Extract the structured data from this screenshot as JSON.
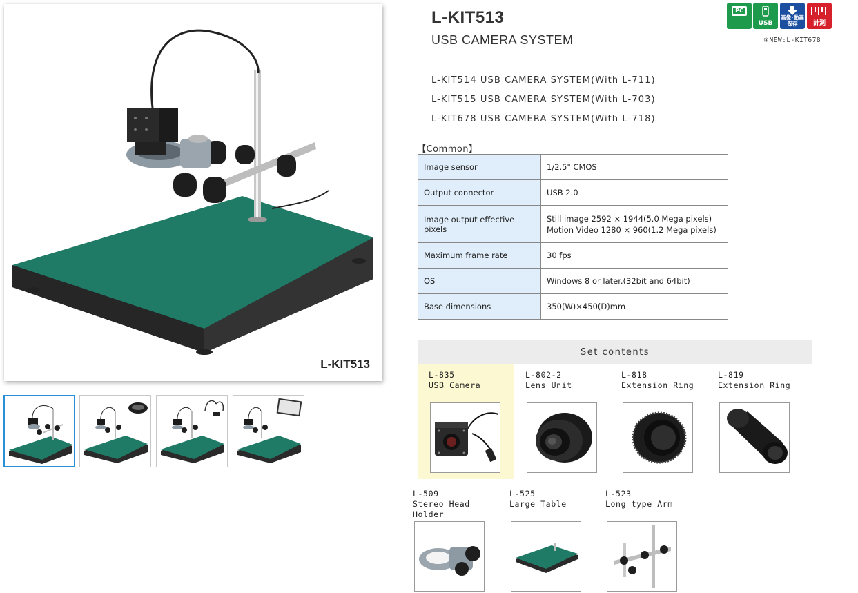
{
  "product": {
    "title": "L-KIT513",
    "subtitle": "USB CAMERA SYSTEM",
    "image_caption": "L-KIT513",
    "new_note": "※NEW:L-KIT678"
  },
  "badges": [
    {
      "label": "PC",
      "icon": "pc-icon",
      "color": "#1e9a4c"
    },
    {
      "label": "USB",
      "icon": "usb-icon",
      "color": "#1e9a4c"
    },
    {
      "label": "画像･動画 保存",
      "icon": "save-download-icon",
      "color": "#1d4fa0"
    },
    {
      "label": "計測",
      "icon": "measure-ruler-icon",
      "color": "#d6202c"
    }
  ],
  "variants": [
    "L-KIT514 USB CAMERA SYSTEM(With L-711)",
    "L-KIT515 USB CAMERA SYSTEM(With L-703)",
    "L-KIT678 USB CAMERA SYSTEM(With L-718)"
  ],
  "spec": {
    "section_label": "【Common】",
    "rows": [
      {
        "key": "Image sensor",
        "values": [
          "1/2.5\" CMOS"
        ]
      },
      {
        "key": "Output connector",
        "values": [
          "USB 2.0"
        ]
      },
      {
        "key": "Image output effective pixels",
        "values": [
          "Still image 2592 × 1944(5.0 Mega pixels)",
          "Motion Video 1280 × 960(1.2 Mega pixels)"
        ]
      },
      {
        "key": "Maximum frame rate",
        "values": [
          "30 fps"
        ]
      },
      {
        "key": "OS",
        "values": [
          "Windows 8 or later.(32bit and 64bit)"
        ]
      },
      {
        "key": "Base dimensions",
        "values": [
          "350(W)×450(D)mm"
        ]
      }
    ]
  },
  "set_contents": {
    "header": "Set contents",
    "items": [
      {
        "code": "L-835",
        "name": "USB Camera"
      },
      {
        "code": "L-802-2",
        "name": "Lens Unit"
      },
      {
        "code": "L-818",
        "name": "Extension Ring"
      },
      {
        "code": "L-819",
        "name": "Extension Ring"
      }
    ]
  },
  "optional_items": [
    {
      "code": "L-509",
      "name_lines": [
        "Stereo Head",
        "Holder"
      ]
    },
    {
      "code": "L-525",
      "name_lines": [
        "Large Table"
      ]
    },
    {
      "code": "L-523",
      "name_lines": [
        "Long type Arm"
      ]
    }
  ],
  "colors": {
    "mat_green": "#1f7a66",
    "key_cell_bg": "#dfeefa",
    "highlight_bg": "#fbf8d2",
    "thumb_active_border": "#2a8fd6"
  }
}
